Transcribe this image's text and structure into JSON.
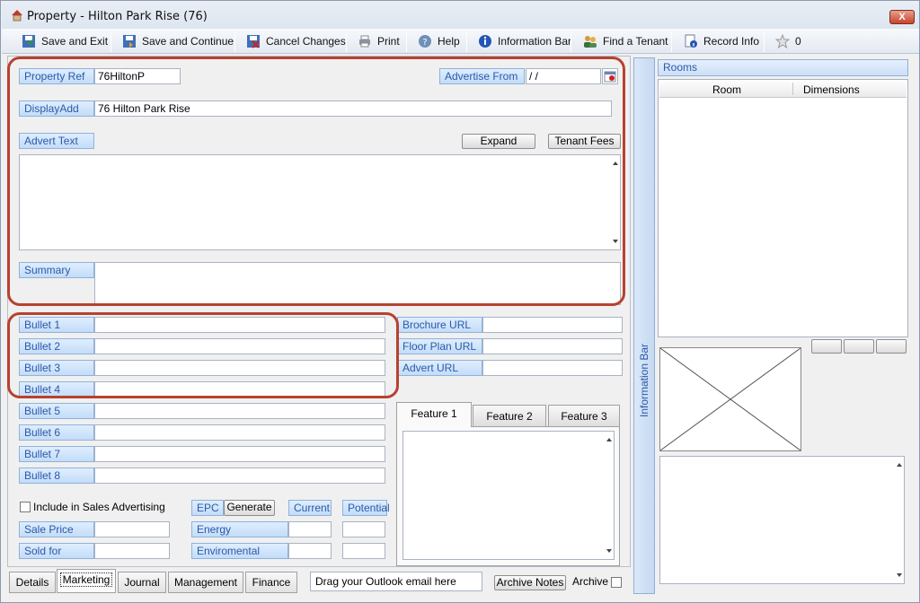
{
  "window": {
    "title": "Property  - Hilton Park Rise (76)",
    "close_label": "X"
  },
  "toolbar": {
    "save_exit": "Save and Exit",
    "save_continue": "Save and Continue",
    "cancel_changes": "Cancel Changes",
    "print": "Print",
    "help": "Help",
    "information_bar": "Information Bar",
    "find_tenant": "Find a Tenant",
    "record_info": "Record Info",
    "star_count": "0"
  },
  "form": {
    "property_ref_label": "Property Ref",
    "property_ref_value": "76HiltonP",
    "advertise_from_label": "Advertise From",
    "advertise_from_value": " / /",
    "display_add_label": "DisplayAdd",
    "display_add_value": "76 Hilton Park Rise",
    "advert_text_label": "Advert Text",
    "expand_label": "Expand",
    "tenant_fees_label": "Tenant Fees",
    "summary_label": "Summary",
    "bullets": [
      "Bullet 1",
      "Bullet 2",
      "Bullet 3",
      "Bullet 4",
      "Bullet 5",
      "Bullet 6",
      "Bullet 7",
      "Bullet 8"
    ],
    "brochure_url_label": "Brochure URL",
    "floor_plan_url_label": "Floor Plan URL",
    "advert_url_label": "Advert URL",
    "include_sales_label": "Include in  Sales Advertising",
    "sale_price_label": "Sale Price",
    "sold_for_label": "Sold for",
    "epc_label": "EPC",
    "generate_label": "Generate",
    "current_label": "Current",
    "potential_label": "Potential",
    "energy_label": "Energy",
    "environmental_label": "Enviromental"
  },
  "features": {
    "tabs": [
      "Feature 1",
      "Feature 2",
      "Feature 3"
    ]
  },
  "side": {
    "info_bar_label": "Information Bar",
    "rooms_title": "Rooms",
    "col_room": "Room",
    "col_dimensions": "Dimensions"
  },
  "bottom": {
    "tabs": [
      "Details",
      "Marketing",
      "Journal",
      "Management",
      "Finance"
    ],
    "drag_outlook": "Drag your Outlook email here",
    "archive_notes": "Archive Notes",
    "archive_label": "Archive"
  },
  "colors": {
    "accent_label": "#2b59a8",
    "highlight_red": "#b8412f"
  }
}
